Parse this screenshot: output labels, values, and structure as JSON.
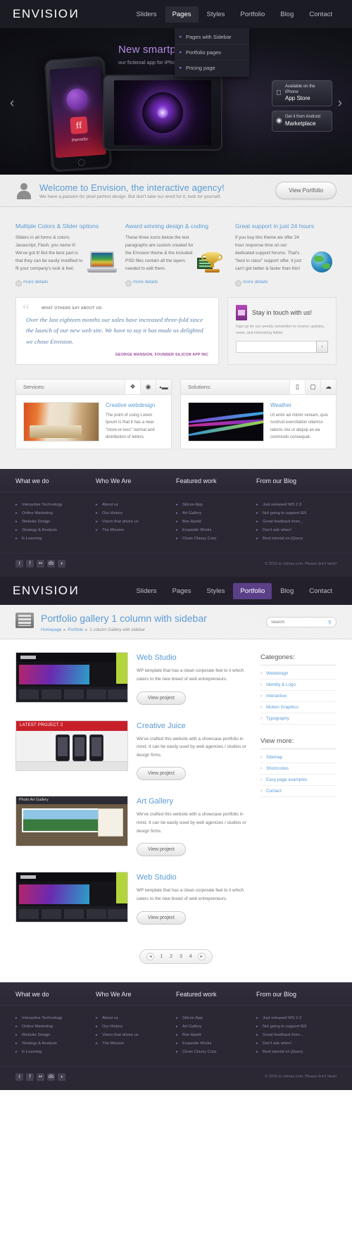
{
  "site": {
    "logo": "ENVISIO",
    "logo_flip": "N"
  },
  "nav": {
    "items": [
      {
        "label": "Sliders",
        "state": "normal"
      },
      {
        "label": "Pages",
        "state": "open"
      },
      {
        "label": "Styles",
        "state": "normal"
      },
      {
        "label": "Portfolio",
        "state": "normal"
      },
      {
        "label": "Blog",
        "state": "normal"
      },
      {
        "label": "Contact",
        "state": "normal"
      }
    ],
    "dropdown": [
      "Pages with Sidebar",
      "Portfolio pages",
      "Pricing page"
    ]
  },
  "nav2": {
    "items": [
      {
        "label": "Sliders",
        "state": "normal"
      },
      {
        "label": "Pages",
        "state": "normal"
      },
      {
        "label": "Styles",
        "state": "normal"
      },
      {
        "label": "Portfolio",
        "state": "active"
      },
      {
        "label": "Blog",
        "state": "normal"
      },
      {
        "label": "Contact",
        "state": "normal"
      }
    ]
  },
  "hero": {
    "title": "New smartphone app",
    "subtitle": "our fictional app for iPhone & Android platforms",
    "phone_label": "themefor",
    "phone_icon_text": "ff",
    "store_primary_small": "Available on the iPhone",
    "store_primary": "App Store",
    "store_secondary_small": "Get it from Android",
    "store_secondary": "Marketplace",
    "arrow_prev": "‹",
    "arrow_next": "›"
  },
  "welcome": {
    "title_pre": "Welcome to ",
    "title_brand": "Envision",
    "title_post": ", the interactive agency!",
    "subtitle": "We have a passion for pixel perfect design. But don't take our word for it, look for yourself.",
    "button": "View Portfolio"
  },
  "features": [
    {
      "title": "Multiple Colors & Slider options",
      "text": "Sliders in all forms & colors: Javascript, Flash, you name it! We've got it! But the best part is that they can be easily modified to fit your company's look & feel.",
      "more": "more details",
      "icon": "laptop-icon"
    },
    {
      "title": "Award winning design & coding",
      "text": "These three icons below the text paragraphs are custom created for the Envision theme & the included PSD files contain all the layers needed to edit them.",
      "more": "more details",
      "icon": "trophy-icon"
    },
    {
      "title": "Great support in just 24 hours",
      "text": "If you buy this theme we offer 24 hour response time on our dedicated support forums. That's \"best in class\" support offer, it just can't get better & faster than this!",
      "more": "more details",
      "icon": "globe-icon"
    }
  ],
  "testimonial": {
    "kicker": "WHAT OTHERS SAY ABOUT US:",
    "quote": "Over the last eighteen months our sales have increased three-fold since the launch of our new web site. We have to say it has made us delighted we chose Envision.",
    "author": "GEORGE MANSION",
    "role": ", FOUNDER SILICON APP INC"
  },
  "newsletter": {
    "title": "Stay in touch with us!",
    "text": "Sign up for our weekly newsletter to receive updates, news, and interesting tidbits",
    "placeholder": "",
    "value": "",
    "submit": "›"
  },
  "panels": [
    {
      "heading": "Services:",
      "tabs": [
        "brush-icon",
        "camera-icon",
        "chart-icon"
      ],
      "selected_tab": 0,
      "item_title": "Creative webdesign",
      "item_text": "The point of using Lorem Ipsum is that it has a near \"more-or-less\" normal and distribution of letters.",
      "thumb": "office-photo"
    },
    {
      "heading": "Solutions:",
      "tabs": [
        "mobile-icon",
        "monitor-icon",
        "cloud-icon"
      ],
      "selected_tab": 0,
      "item_title": "Weather",
      "item_text": "Ut enim ad minim veniam, quis nostrud exercitation ullamco laboris nisi ut aliquip ex ea commodo consequat.",
      "thumb": "wave-photo"
    }
  ],
  "footer": {
    "headings": [
      "What we do",
      "Who We Are",
      "Featured work",
      "From our Blog"
    ],
    "columns": [
      [
        "Interactive Technology",
        "Online Marketing",
        "Website Design",
        "Strategy & Analysis",
        "E-Learning"
      ],
      [
        "About us",
        "Our History",
        "Vision that drives us",
        "The Mission"
      ],
      [
        "Silicon App",
        "Art Gallery",
        "Bon Apetit",
        "Exquisite Works",
        "Clean Classy Corp"
      ],
      [
        "Just released WS 2.3",
        "Not going to support IE6",
        "Great feedback from...",
        "Don't ask when!",
        "Best tutorial on jQuery"
      ]
    ],
    "social": [
      "twitter-icon",
      "facebook-icon",
      "flickr-icon",
      "dribbble-icon",
      "rss-icon"
    ],
    "social_glyphs": [
      "t",
      "f",
      "••",
      "db",
      "◖"
    ],
    "copyright": "© 2013 sc.chinaz.com. Please don't steal!"
  },
  "portfolio": {
    "title_pre": "Portfolio gallery ",
    "title_accent": "1 column with sidebar",
    "crumbs": {
      "home": "Homepage",
      "section": "Portfolio",
      "current": "1 column Gallery with sidebar"
    },
    "search_placeholder": "Search",
    "search_value": "",
    "view_button": "View project",
    "items": [
      {
        "title": "Web Studio",
        "text": "WP template that has a clean corporate feel to it which caters to the new breed of web entrepreneurs.",
        "thumb": "web-studio-shot"
      },
      {
        "title": "Creative Juice",
        "text": "We've crafted this website with a showcase portfolio in mind. It can be easily used by web agencies / studios or design firms.",
        "thumb": "creative-juice-shot"
      },
      {
        "title": "Art Gallery",
        "text": "We've crafted this website with a showcase portfolio in mind. It can be easily used by web agencies / studios or design firms.",
        "thumb": "art-gallery-shot"
      },
      {
        "title": "Web Studio",
        "text": "WP template that has a clean corporate feel to it which caters to the new breed of web entrepreneurs.",
        "thumb": "web-studio-shot"
      }
    ],
    "sidebar": {
      "categories_title": "Categories:",
      "categories": [
        "Webdesign",
        "Identity & Logo",
        "Interactive",
        "Motion Graphics",
        "Typography"
      ],
      "viewmore_title": "View more:",
      "viewmore": [
        "Sitemap",
        "Shortcodes",
        "Easy page examples",
        "Contact"
      ]
    },
    "pagination": {
      "prev": "◄",
      "next": "►",
      "pages": [
        "1",
        "2",
        "3",
        "4"
      ]
    }
  },
  "colors": {
    "accent_blue": "#5b9bd5",
    "purple": "#5b3f87",
    "dark": "#1b1b24",
    "footer": "#2b2733"
  }
}
